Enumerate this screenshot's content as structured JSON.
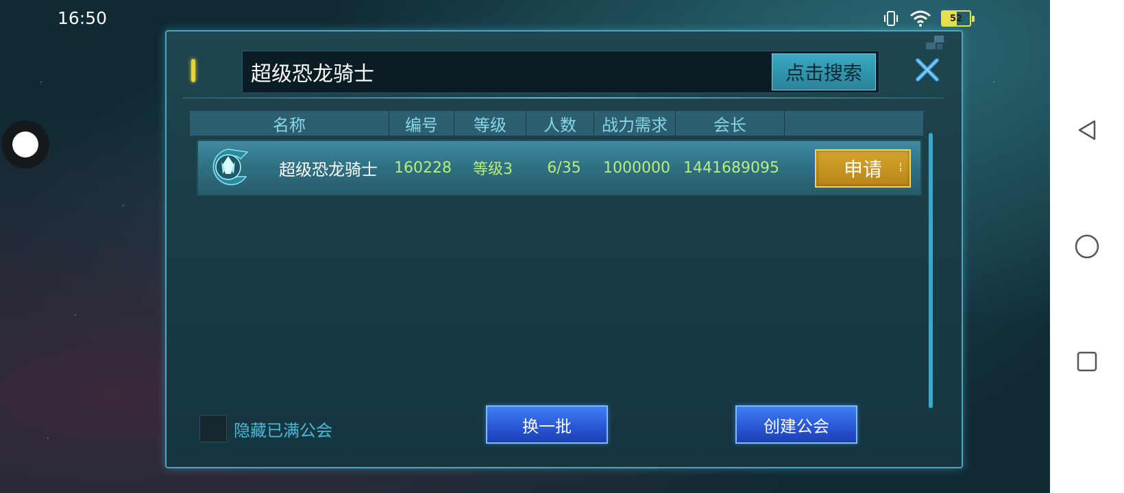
{
  "status_bar": {
    "time": "16:50",
    "battery": "52",
    "icons": [
      "vibrate-icon",
      "wifi-icon",
      "battery-icon"
    ]
  },
  "nav_bar": {
    "icons": [
      "back-triangle-icon",
      "home-circle-icon",
      "recents-square-icon"
    ]
  },
  "search": {
    "value": "超级恐龙骑士",
    "button_label": "点击搜索"
  },
  "table": {
    "headers": [
      "名称",
      "编号",
      "等级",
      "人数",
      "战力需求",
      "会长"
    ],
    "rows": [
      {
        "name": "超级恐龙骑士",
        "id": "160228",
        "level": "等级3",
        "members": "6/35",
        "power_required": "1000000",
        "leader": "1441689095",
        "action_label": "申请"
      }
    ]
  },
  "footer": {
    "hide_full_label": "隐藏已满公会",
    "refresh_label": "换一批",
    "create_label": "创建公会"
  },
  "colors": {
    "accent_cyan": "#5bc3dd",
    "apply_gold": "#d6a52c",
    "button_blue": "#2755d4",
    "value_green": "#b6f07a"
  }
}
